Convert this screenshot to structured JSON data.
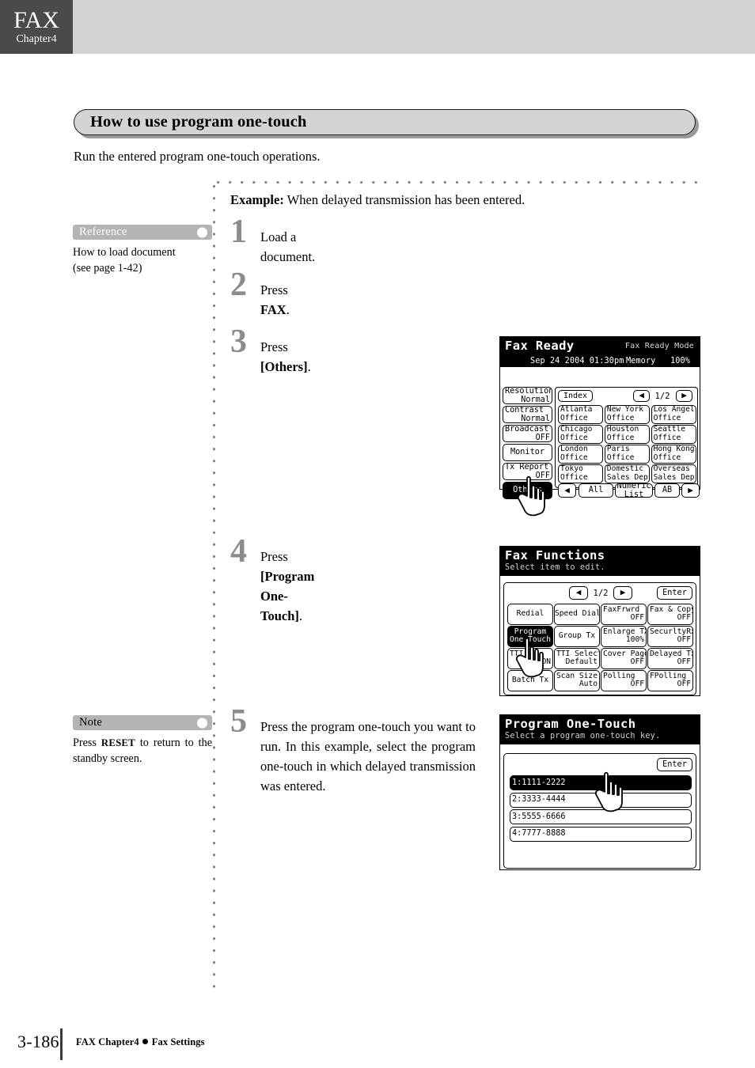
{
  "header": {
    "chapter_title": "FAX",
    "chapter_sub": "Chapter4"
  },
  "section": {
    "title": "How to use program one-touch",
    "intro": "Run the entered program one-touch operations."
  },
  "example": {
    "label": "Example:",
    "text": " When delayed transmission has been entered."
  },
  "margin_notes": [
    {
      "tag": "Reference",
      "icon": "circle-icon",
      "body_line1": "How to load document",
      "body_line2": "(see page 1-42)"
    },
    {
      "tag": "Note",
      "icon": "circle-icon",
      "body_prefix": "Press ",
      "body_bold": "RESET",
      "body_suffix": " to return to the standby screen."
    }
  ],
  "steps": [
    {
      "num": "1",
      "text": "Load a document."
    },
    {
      "num": "2",
      "prefix": "Press ",
      "bold": "FAX",
      "suffix": "."
    },
    {
      "num": "3",
      "prefix": "Press ",
      "bold": "[Others]",
      "suffix": "."
    },
    {
      "num": "4",
      "prefix": "Press ",
      "bold": "[Program One-Touch]",
      "suffix": "."
    },
    {
      "num": "5",
      "text": "Press the program one-touch you want to run. In this example, select the program one-touch in which delayed transmission was entered."
    }
  ],
  "lcd1": {
    "title": "Fax Ready",
    "mode": "Fax Ready Mode",
    "date": "Sep 24 2004 01:30pm",
    "memory_label": "Memory",
    "memory_value": "100%",
    "left_keys": [
      {
        "label": "Resolution",
        "value": "Normal"
      },
      {
        "label": "Contrast",
        "value": "Normal"
      },
      {
        "label": "Broadcast",
        "value": "OFF"
      },
      {
        "label": "Monitor",
        "value": ""
      },
      {
        "label": "Tx Report",
        "value": "OFF"
      },
      {
        "label": "Others",
        "value": "",
        "selected": true
      }
    ],
    "index_label": "Index",
    "page_prev": "◀",
    "page_indicator": "1/2",
    "page_next": "▶",
    "one_touch_keys": [
      {
        "l1": "Atlanta",
        "l2": "Office"
      },
      {
        "l1": "New York",
        "l2": "Office"
      },
      {
        "l1": "Los Angels",
        "l2": "Office"
      },
      {
        "l1": "Chicago",
        "l2": "Office"
      },
      {
        "l1": "Houston",
        "l2": "Office"
      },
      {
        "l1": "Seattle",
        "l2": "Office"
      },
      {
        "l1": "London",
        "l2": "Office"
      },
      {
        "l1": "Paris",
        "l2": "Office"
      },
      {
        "l1": "Hong Kong",
        "l2": "Office"
      },
      {
        "l1": "Tokyo",
        "l2": "Office"
      },
      {
        "l1": "Domestic",
        "l2": "Sales Dep"
      },
      {
        "l1": "Overseas",
        "l2": "Sales Dep"
      }
    ],
    "bottom": {
      "prev": "◀",
      "all": "All",
      "numeric_l1": "Numeric",
      "numeric_l2": "List",
      "ab": "AB",
      "next": "▶"
    }
  },
  "lcd2": {
    "title": "Fax Functions",
    "subtitle": "Select item to edit.",
    "page_prev": "◀",
    "page_indicator": "1/2",
    "page_next": "▶",
    "enter_label": "Enter",
    "function_keys": [
      {
        "l1": "Redial",
        "l2": "",
        "center": true
      },
      {
        "l1": "Speed Dial",
        "l2": "",
        "center": true
      },
      {
        "l1": "FaxFrwrd",
        "l2": "OFF"
      },
      {
        "l1": "Fax & Copy",
        "l2": "OFF"
      },
      {
        "l1": "Program",
        "l2": "One-Touch",
        "center": true,
        "selected": true
      },
      {
        "l1": "Group Tx",
        "l2": "",
        "center": true
      },
      {
        "l1": "Enlarge TX",
        "l2": "100%"
      },
      {
        "l1": "SecurltyRx",
        "l2": "OFF"
      },
      {
        "l1": "TTI",
        "l2": "ON"
      },
      {
        "l1": "TTI Select",
        "l2": "Default"
      },
      {
        "l1": "Cover Page",
        "l2": "OFF"
      },
      {
        "l1": "Delayed Tx",
        "l2": "OFF"
      },
      {
        "l1": "Batch Tx",
        "l2": "",
        "center": true
      },
      {
        "l1": "Scan Size",
        "l2": "Auto"
      },
      {
        "l1": "Polling",
        "l2": "OFF"
      },
      {
        "l1": "FPolling",
        "l2": "OFF"
      }
    ]
  },
  "lcd3": {
    "title": "Program One-Touch",
    "subtitle": "Select a program one-touch key.",
    "enter_label": "Enter",
    "program_keys": [
      {
        "label": "1:1111-2222",
        "selected": true
      },
      {
        "label": "2:3333-4444",
        "selected": false
      },
      {
        "label": "3:5555-6666",
        "selected": false
      },
      {
        "label": "4:7777-8888",
        "selected": false
      }
    ]
  },
  "footer": {
    "page_number": "3-186",
    "text_left": "FAX Chapter4",
    "text_right": "Fax Settings"
  }
}
